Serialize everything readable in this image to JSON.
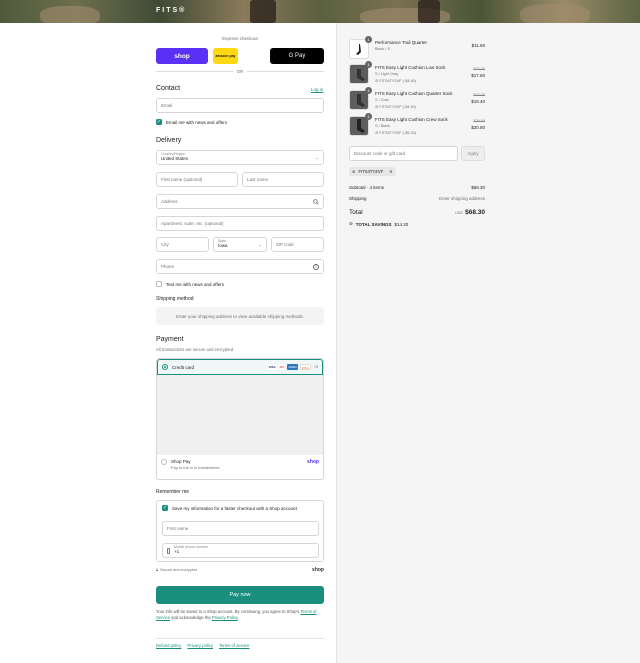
{
  "header": {
    "brand": "FITS®"
  },
  "express": {
    "title": "Express checkout",
    "shop_label": "shop",
    "amazon_label": "amazon pay",
    "gpay_label": "G Pay",
    "or_label": "OR"
  },
  "contact": {
    "heading": "Contact",
    "login_label": "Log in",
    "email_placeholder": "Email",
    "news_label": "Email me with news and offers"
  },
  "delivery": {
    "heading": "Delivery",
    "country_label": "Country/Region",
    "country_value": "United States",
    "first_name": "First name (optional)",
    "last_name": "Last name",
    "address": "Address",
    "apartment": "Apartment, suite, etc. (optional)",
    "city": "City",
    "state_label": "State",
    "state_value": "Iowa",
    "zip": "ZIP code",
    "phone": "Phone",
    "text_label": "Text me with news and offers"
  },
  "shipping": {
    "heading": "Shipping method",
    "message": "Enter your shipping address to view available shipping methods."
  },
  "payment": {
    "heading": "Payment",
    "subtitle": "All transactions are secure and encrypted.",
    "credit_label": "Credit card",
    "more_cards": "+3",
    "card_badges": [
      "VISA",
      "MC",
      "AMEX",
      "DISC"
    ],
    "shoppay_label": "Shop Pay",
    "shoppay_sub": "Pay in full or in installments",
    "shoppay_brand": "shop"
  },
  "remember": {
    "heading": "Remember me",
    "save_label": "Save my information for a faster checkout with a Shop account",
    "first_name": "First name",
    "mobile_label": "Mobile phone number",
    "mobile_value": "+1",
    "secure_label": "Secure and encrypted",
    "shop_brand": "shop"
  },
  "pay_now": "Pay now",
  "legal": {
    "text_1": "Your info will be saved to a Shop account. By continuing, you agree to Shop's",
    "terms": "Terms of Service",
    "text_2": "and acknowledge the",
    "privacy": "Privacy Policy",
    "text_3": "."
  },
  "footer": {
    "refund": "Refund policy",
    "privacy": "Privacy policy",
    "terms": "Terms of service"
  },
  "cart": {
    "items": [
      {
        "qty": "1",
        "name": "Performance Trail Quarter",
        "variant": "Black / S",
        "discount": "",
        "old_price": "",
        "price": "$11.50",
        "dark": false
      },
      {
        "qty": "1",
        "name": "FITS Easy Light Cushion Low Sock",
        "variant": "S / Light Gray",
        "discount": "FITS4TYZVF (-$4.40)",
        "old_price": "$22.00",
        "price": "$17.60",
        "dark": true
      },
      {
        "qty": "1",
        "name": "FITS Easy Light Cushion Quarter Sock",
        "variant": "S / Coal",
        "discount": "FITS4TYZVF (-$4.60)",
        "old_price": "$23.00",
        "price": "$18.40",
        "dark": true
      },
      {
        "qty": "1",
        "name": "FITS Easy Light Cushion Crew Sock",
        "variant": "S / Black",
        "discount": "FITS4TYZVF (-$5.20)",
        "old_price": "$26.00",
        "price": "$20.80",
        "dark": true
      }
    ],
    "discount_placeholder": "Discount code or gift card",
    "apply_label": "Apply",
    "code": "FITS4TYZVF",
    "subtotal_label": "Subtotal · 4 items",
    "subtotal_value": "$68.30",
    "shipping_label": "Shipping",
    "shipping_value": "Enter shipping address",
    "total_label": "Total",
    "currency": "USD",
    "total_value": "$68.30",
    "savings_label": "TOTAL SAVINGS",
    "savings_value": "$14.20"
  },
  "colors": {
    "accent": "#1a8f7e",
    "shop": "#5a31f4",
    "amazon": "#ffd814"
  }
}
